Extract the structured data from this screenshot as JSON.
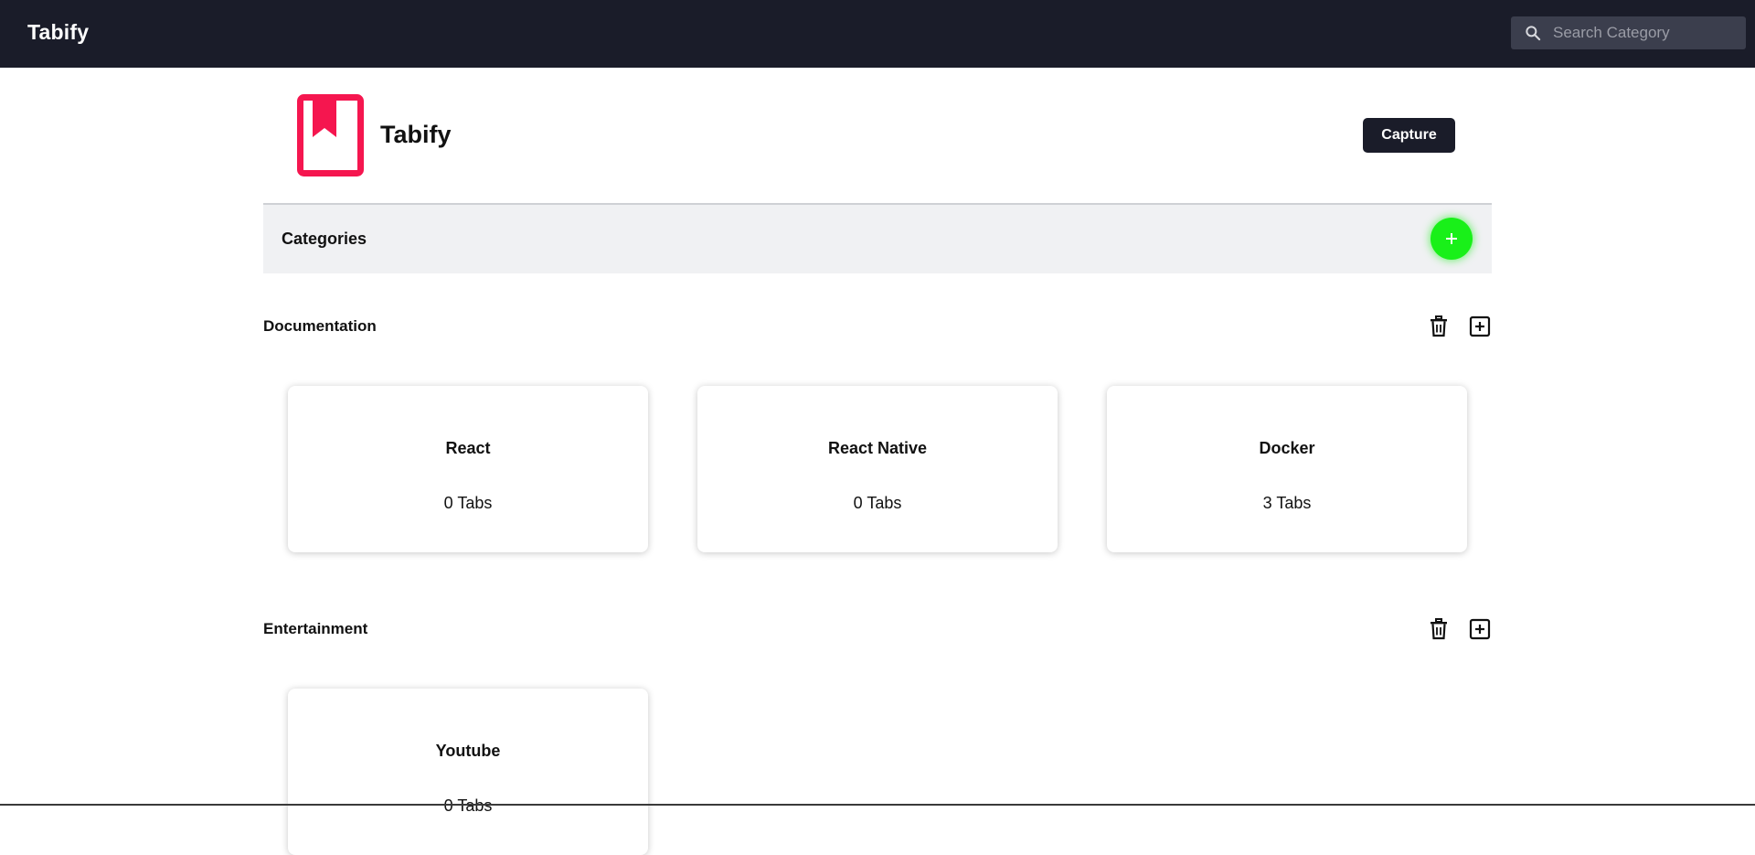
{
  "navbar": {
    "brand": "Tabify",
    "search": {
      "placeholder": "Search Category",
      "value": ""
    }
  },
  "header": {
    "logo_icon": "bookmark-book-icon",
    "title": "Tabify",
    "capture_label": "Capture"
  },
  "categories_bar": {
    "title": "Categories",
    "add_icon": "plus-icon"
  },
  "colors": {
    "navbar": "#1a1c29",
    "logo": "#f5164f",
    "add_button": "#19f019",
    "capture_button": "#1a1c29"
  },
  "categories": [
    {
      "name": "Documentation",
      "cards": [
        {
          "title": "React",
          "count": "0 Tabs"
        },
        {
          "title": "React Native",
          "count": "0 Tabs"
        },
        {
          "title": "Docker",
          "count": "3 Tabs"
        }
      ]
    },
    {
      "name": "Entertainment",
      "cards": [
        {
          "title": "Youtube",
          "count": "0 Tabs"
        }
      ]
    }
  ]
}
